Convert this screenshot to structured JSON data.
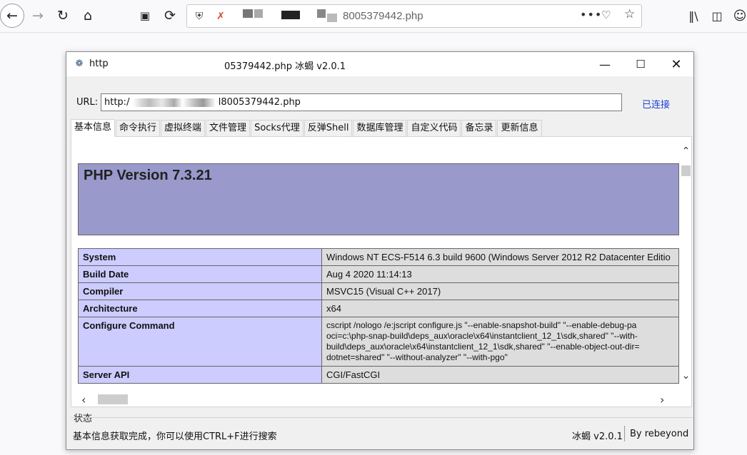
{
  "browser": {
    "url_text": "8005379442.php",
    "icons": {
      "back": "back-arrow-icon",
      "forward": "forward-arrow-icon",
      "reload": "reload-icon",
      "home": "home-icon",
      "screenshot": "screenshot-icon",
      "history": "history-icon",
      "shield": "tracking-shield-icon",
      "insecure": "insecure-lock-icon",
      "more": "more-actions-icon",
      "pocket": "pocket-icon",
      "bookmark": "bookmark-star-icon",
      "library": "library-icon",
      "sidebar": "sidebar-icon",
      "account": "account-icon"
    }
  },
  "app": {
    "title_prefix": "http:",
    "title_suffix": "05379442.php    冰蝎 v2.0.1",
    "url_label": "URL:",
    "url_value_prefix": "http:/",
    "url_value_suffix": "l8005379442.php",
    "connection_status": "已连接",
    "tabs": [
      {
        "label": "基本信息",
        "active": true
      },
      {
        "label": "命令执行"
      },
      {
        "label": "虚拟终端"
      },
      {
        "label": "文件管理"
      },
      {
        "label": "Socks代理"
      },
      {
        "label": "反弹Shell"
      },
      {
        "label": "数据库管理"
      },
      {
        "label": "自定义代码"
      },
      {
        "label": "备忘录"
      },
      {
        "label": "更新信息"
      }
    ],
    "php_version_title": "PHP Version 7.3.21",
    "info_rows": [
      {
        "key": "System",
        "value": "Windows NT ECS-F514 6.3 build 9600 (Windows Server 2012 R2 Datacenter Editio"
      },
      {
        "key": "Build Date",
        "value": "Aug 4 2020 11:14:13"
      },
      {
        "key": "Compiler",
        "value": "MSVC15 (Visual C++ 2017)"
      },
      {
        "key": "Architecture",
        "value": "x64"
      },
      {
        "key": "Configure Command",
        "value": "cscript /nologo /e:jscript configure.js \"--enable-snapshot-build\" \"--enable-debug-pa\noci=c:\\php-snap-build\\deps_aux\\oracle\\x64\\instantclient_12_1\\sdk,shared\" \"--with-\nbuild\\deps_aux\\oracle\\x64\\instantclient_12_1\\sdk,shared\" \"--enable-object-out-dir=\ndotnet=shared\" \"--without-analyzer\" \"--with-pgo\""
      },
      {
        "key": "Server API",
        "value": "CGI/FastCGI"
      }
    ],
    "status_section_label": "状态",
    "status_message": "基本信息获取完成，你可以使用CTRL+F进行搜索",
    "footer_version": "冰蝎 v2.0.1",
    "footer_author": "By rebeyond"
  }
}
